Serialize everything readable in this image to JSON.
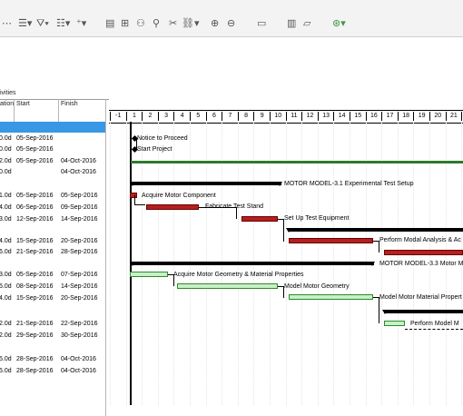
{
  "toolbar": {
    "icons": [
      "undo-icon",
      "outline-icon",
      "filter-icon",
      "group-icon",
      "dropdown-icon",
      "chart-icon",
      "gantt-icon",
      "network-icon",
      "pin-icon",
      "scissors-icon",
      "link-icon",
      "zoom-in-icon",
      "zoom-out-icon",
      "page-icon",
      "layout-icon",
      "comment-icon",
      "help-icon"
    ]
  },
  "grid": {
    "col_activities": "ivities",
    "col_duration": "ation",
    "col_start": "Start",
    "col_finish": "Finish",
    "rows": [
      {
        "dur": "0.0d",
        "start": "05-Sep-2016",
        "finish": ""
      },
      {
        "dur": "0.0d",
        "start": "05-Sep-2016",
        "finish": ""
      },
      {
        "dur": "2.0d",
        "start": "05-Sep-2016",
        "finish": "04-Oct-2016"
      },
      {
        "dur": "0.0d",
        "start": "",
        "finish": "04-Oct-2016"
      },
      {
        "dur": "1.0d",
        "start": "05-Sep-2016",
        "finish": "05-Sep-2016"
      },
      {
        "dur": "4.0d",
        "start": "06-Sep-2016",
        "finish": "09-Sep-2016"
      },
      {
        "dur": "3.0d",
        "start": "12-Sep-2016",
        "finish": "14-Sep-2016"
      },
      {
        "dur": "4.0d",
        "start": "15-Sep-2016",
        "finish": "20-Sep-2016"
      },
      {
        "dur": "6.0d",
        "start": "21-Sep-2016",
        "finish": "28-Sep-2016"
      },
      {
        "dur": "3.0d",
        "start": "05-Sep-2016",
        "finish": "07-Sep-2016"
      },
      {
        "dur": "5.0d",
        "start": "08-Sep-2016",
        "finish": "14-Sep-2016"
      },
      {
        "dur": "4.0d",
        "start": "15-Sep-2016",
        "finish": "20-Sep-2016"
      },
      {
        "dur": "2.0d",
        "start": "21-Sep-2016",
        "finish": "22-Sep-2016"
      },
      {
        "dur": "2.0d",
        "start": "29-Sep-2016",
        "finish": "30-Sep-2016"
      },
      {
        "dur": "5.0d",
        "start": "28-Sep-2016",
        "finish": "04-Oct-2016"
      },
      {
        "dur": "5.0d",
        "start": "28-Sep-2016",
        "finish": "04-Oct-2016"
      }
    ]
  },
  "timescale": [
    "-1",
    "1",
    "2",
    "3",
    "4",
    "5",
    "6",
    "7",
    "8",
    "9",
    "10",
    "11",
    "12",
    "13",
    "14",
    "15",
    "16",
    "17",
    "18",
    "19",
    "20",
    "21",
    "2"
  ],
  "labels": {
    "notice": "Notice to Proceed",
    "start_project": "Start Project",
    "wbs1": "MOTOR MODEL-3.1  Experimental Test Setup",
    "acquire": "Acquire Motor Component",
    "fabricate": "Fabricate Test Stand",
    "setup": "Set Up Test Equipment",
    "modal": "Perform Modal Analysis & Ac",
    "wbs3": "MOTOR MODEL-3.3  Motor Model",
    "geometry": "Acquire Motor Geometry & Material Properties",
    "model_geometry": "Model Motor Geometry",
    "material": "Model Motor Material Propert",
    "perform_model": "Perform Model M"
  },
  "colors": {
    "critical": "#b3201f",
    "normal": "#c8f0c8",
    "selection": "#3a97e5",
    "summary": "#000000"
  }
}
